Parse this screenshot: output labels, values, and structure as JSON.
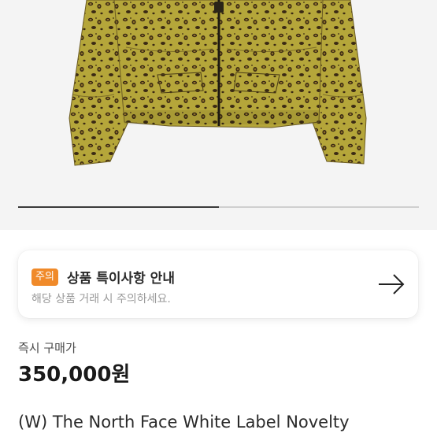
{
  "product": {
    "image_alt": "Leopard print cropped puffer jacket",
    "carousel_progress": 0.5
  },
  "notice": {
    "badge": "주의",
    "title": "상품 특이사항 안내",
    "description": "해당 상품 거래 시 주의하세요.",
    "arrow_icon": "arrow-right-icon"
  },
  "purchase": {
    "label": "즉시 구매가",
    "price": "350,000원"
  },
  "listing": {
    "title": "(W) The North Face White Label Novelty"
  },
  "colors": {
    "badge_bg": "#f08a2a",
    "jacket_base": "#b5a63a"
  }
}
